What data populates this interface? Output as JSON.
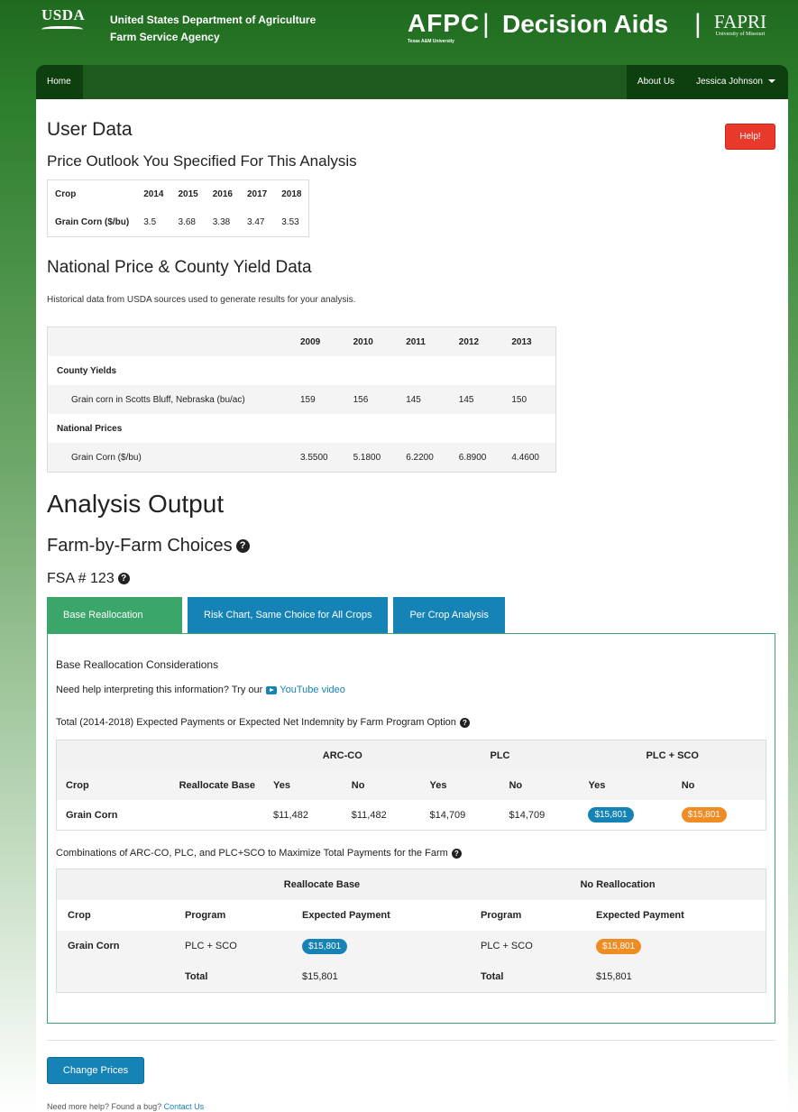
{
  "banner": {
    "usda": "USDA",
    "agency_line1": "United States Department of Agriculture",
    "agency_line2": "Farm Service Agency",
    "afpc": "AFPC",
    "afpc_sub": "Texas A&M University",
    "divider": "|",
    "decision_aids": "Decision Aids",
    "fapri": "FAPRI",
    "fapri_sub": "University of Missouri"
  },
  "nav": {
    "home": "Home",
    "about": "About Us",
    "user": "Jessica Johnson"
  },
  "user_data": {
    "title": "User Data",
    "help_label": "Help!",
    "outlook_title": "Price Outlook You Specified For This Analysis",
    "columns": [
      "Crop",
      "2014",
      "2015",
      "2016",
      "2017",
      "2018"
    ],
    "row": [
      "Grain Corn ($/bu)",
      "3.5",
      "3.68",
      "3.38",
      "3.47",
      "3.53"
    ]
  },
  "national": {
    "title": "National Price & County Yield Data",
    "description": "Historical data from USDA sources used to generate results for your analysis.",
    "years": [
      "2009",
      "2010",
      "2011",
      "2012",
      "2013"
    ],
    "county_label": "County Yields",
    "county_row": [
      "Grain corn in Scotts Bluff, Nebraska (bu/ac)",
      "159",
      "156",
      "145",
      "145",
      "150"
    ],
    "prices_label": "National Prices",
    "prices_row": [
      "Grain Corn ($/bu)",
      "3.5500",
      "5.1800",
      "6.2200",
      "6.8900",
      "4.4600"
    ]
  },
  "analysis": {
    "title": "Analysis Output",
    "farm_title": "Farm-by-Farm Choices",
    "fsa_title": "FSA # 123",
    "help_icon": "?"
  },
  "tabs": [
    {
      "label": "Base Reallocation"
    },
    {
      "label": "Risk Chart, Same Choice for All Crops"
    },
    {
      "label": "Per Crop Analysis"
    }
  ],
  "panel": {
    "heading": "Base Reallocation Considerations",
    "help_prefix": "Need help interpreting this information? Try our",
    "youtube_link": "YouTube video",
    "total_title": "Total (2014-2018) Expected Payments or Expected Net Indemnity by Farm Program Option",
    "groups": [
      "ARC-CO",
      "PLC",
      "PLC + SCO"
    ],
    "sub_headers": [
      "Crop",
      "Reallocate Base",
      "Yes",
      "No",
      "Yes",
      "No",
      "Yes",
      "No"
    ],
    "payment_row": {
      "crop": "Grain Corn",
      "arc_yes": "$11,482",
      "arc_no": "$11,482",
      "plc_yes": "$14,709",
      "plc_no": "$14,709",
      "sco_yes": "$15,801",
      "sco_no": "$15,801"
    },
    "combo_title": "Combinations of ARC-CO, PLC, and PLC+SCO to Maximize Total Payments for the Farm",
    "combo_groups": [
      "Reallocate Base",
      "No Reallocation"
    ],
    "combo_headers": [
      "Crop",
      "Program",
      "Expected Payment",
      "Program",
      "Expected Payment"
    ],
    "combo_row": {
      "crop": "Grain Corn",
      "realloc_program": "PLC + SCO",
      "realloc_payment": "$15,801",
      "noreal_program": "PLC + SCO",
      "noreal_payment": "$15,801"
    },
    "combo_total": {
      "label1": "Total",
      "value1": "$15,801",
      "label2": "Total",
      "value2": "$15,801"
    }
  },
  "footer": {
    "change_prices": "Change Prices",
    "help_text": "Need more help? Found a bug?",
    "contact": "Contact Us"
  },
  "colors": {
    "header_green": "#2d7f2d",
    "tab_active": "#3aa66a",
    "tab_blue": "#1583b6",
    "help_red": "#e8392b",
    "pill_blue": "#1583b6",
    "pill_orange": "#ef8c24"
  }
}
